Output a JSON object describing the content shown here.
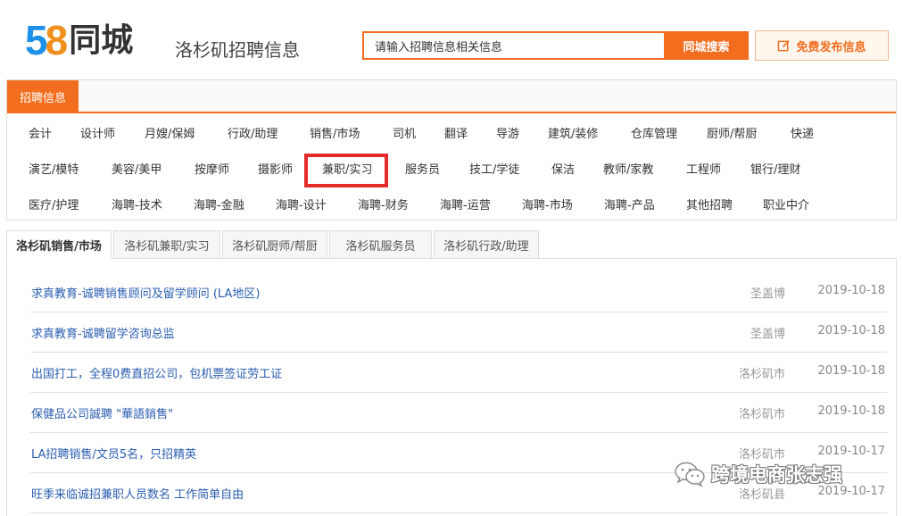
{
  "brand": {
    "num_5": "5",
    "num_8": "8",
    "name": "同城",
    "orange": "#f26d1e",
    "blue": "#1e90e8"
  },
  "header": {
    "city_title": "洛杉矶招聘信息"
  },
  "search": {
    "value": "请输入招聘信息相关信息",
    "button": "同城搜索"
  },
  "post_button": {
    "label": "免费发布信息",
    "icon": "edit-icon"
  },
  "jobs_panel": {
    "tab": "招聘信息",
    "rows": [
      [
        "会计",
        "设计师",
        "月嫂/保姆",
        "行政/助理",
        "销售/市场",
        "司机",
        "翻译",
        "导游",
        "建筑/装修",
        "仓库管理",
        "厨师/帮厨",
        "快递"
      ],
      [
        "演艺/模特",
        "美容/美甲",
        "按摩师",
        "摄影师",
        "兼职/实习",
        "服务员",
        "技工/学徒",
        "保洁",
        "教师/家教",
        "工程师",
        "银行/理财"
      ],
      [
        "医疗/护理",
        "海聘-技术",
        "海聘-金融",
        "海聘-设计",
        "海聘-财务",
        "海聘-运营",
        "海聘-市场",
        "海聘-产品",
        "其他招聘",
        "职业中介"
      ]
    ],
    "highlighted": "兼职/实习"
  },
  "tabs": [
    "洛杉矶销售/市场",
    "洛杉矶兼职/实习",
    "洛杉矶厨师/帮厨",
    "洛杉矶服务员",
    "洛杉矶行政/助理"
  ],
  "listings": [
    {
      "title": "求真教育-诚聘销售顾问及留学顾问 (LA地区)",
      "location": "圣盖博",
      "date": "2019-10-18"
    },
    {
      "title": "求真教育-诚聘留学咨询总监",
      "location": "圣盖博",
      "date": "2019-10-18"
    },
    {
      "title": "出国打工，全程0费直招公司，包机票签证劳工证",
      "location": "洛杉矶市",
      "date": "2019-10-18"
    },
    {
      "title": "保健品公司誠聘 \"華語銷售\"",
      "location": "洛杉矶市",
      "date": "2019-10-18"
    },
    {
      "title": "LA招聘销售/文员5名，只招精英",
      "location": "洛杉矶市",
      "date": "2019-10-17"
    },
    {
      "title": "旺季来临诚招兼职人员数名 工作简单自由",
      "location": "洛杉矶县",
      "date": "2019-10-17"
    }
  ],
  "watermark": {
    "text": "跨境电商张志强",
    "icon": "wechat-icon"
  }
}
